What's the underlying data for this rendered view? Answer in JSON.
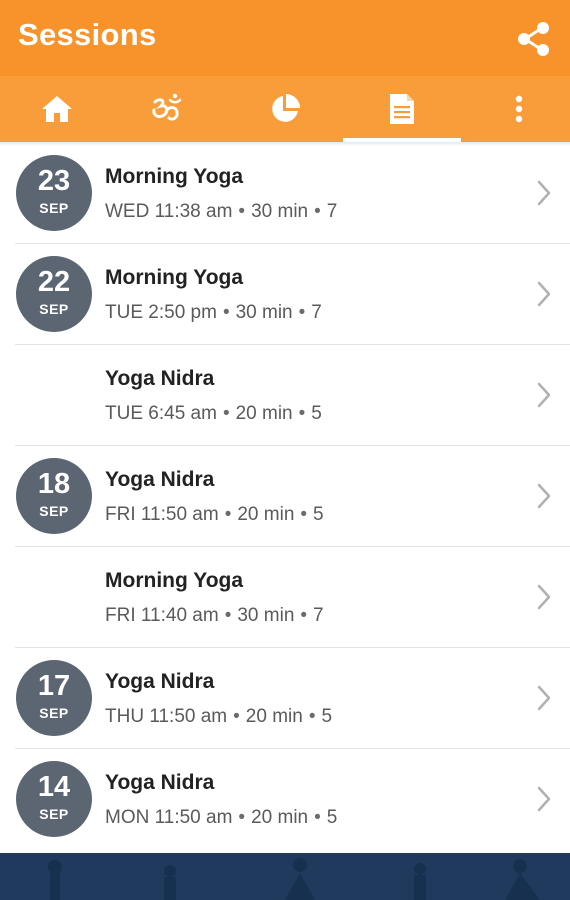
{
  "header": {
    "title": "Sessions",
    "share_icon": "share-icon"
  },
  "tabs": [
    {
      "icon": "home-icon",
      "selected": false
    },
    {
      "icon": "om-icon",
      "selected": false
    },
    {
      "icon": "pie-chart-icon",
      "selected": false
    },
    {
      "icon": "document-icon",
      "selected": true
    },
    {
      "icon": "overflow-menu-icon",
      "selected": false
    }
  ],
  "sessions": [
    {
      "day": "23",
      "month": "SEP",
      "name": "Morning Yoga",
      "time": "WED 11:38 am",
      "duration": "30 min",
      "count": "7"
    },
    {
      "day": "22",
      "month": "SEP",
      "name": "Morning Yoga",
      "time": "TUE 2:50 pm",
      "duration": "30 min",
      "count": "7"
    },
    {
      "day": "",
      "month": "",
      "name": "Yoga Nidra",
      "time": "TUE 6:45 am",
      "duration": "20 min",
      "count": "5"
    },
    {
      "day": "18",
      "month": "SEP",
      "name": "Yoga Nidra",
      "time": "FRI 11:50 am",
      "duration": "20 min",
      "count": "5"
    },
    {
      "day": "",
      "month": "",
      "name": "Morning Yoga",
      "time": "FRI 11:40 am",
      "duration": "30 min",
      "count": "7"
    },
    {
      "day": "17",
      "month": "SEP",
      "name": "Yoga Nidra",
      "time": "THU 11:50 am",
      "duration": "20 min",
      "count": "5"
    },
    {
      "day": "14",
      "month": "SEP",
      "name": "Yoga Nidra",
      "time": "MON 11:50 am",
      "duration": "20 min",
      "count": "5"
    }
  ],
  "colors": {
    "appbar": "#f7932a",
    "tabbar": "#f99d3b",
    "badge": "#5b6672",
    "banner": "#1f3a5c"
  }
}
